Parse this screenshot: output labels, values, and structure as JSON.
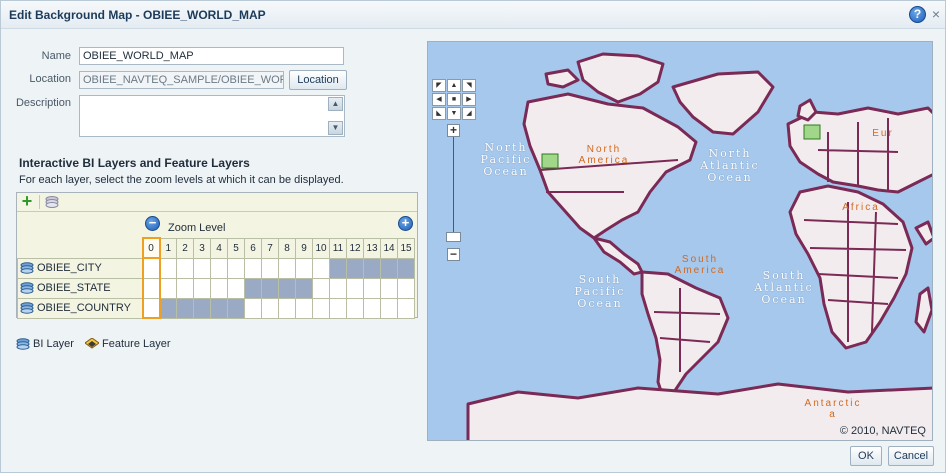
{
  "dialog": {
    "title": "Edit Background Map - OBIEE_WORLD_MAP",
    "help_glyph": "?",
    "close_glyph": "×"
  },
  "form": {
    "name_label": "Name",
    "name_value": "OBIEE_WORLD_MAP",
    "location_label": "Location",
    "location_value": "OBIEE_NAVTEQ_SAMPLE/OBIEE_WORLD_",
    "location_button": "Location",
    "description_label": "Description",
    "description_value": ""
  },
  "layers": {
    "title": "Interactive BI Layers and Feature Layers",
    "description": "For each layer, select the zoom levels at which it can be displayed.",
    "add_glyph": "+",
    "zoom_label": "Zoom Level",
    "zoom_out_glyph": "−",
    "zoom_in_glyph": "+",
    "levels": [
      "0",
      "1",
      "2",
      "3",
      "4",
      "5",
      "6",
      "7",
      "8",
      "9",
      "10",
      "11",
      "12",
      "13",
      "14",
      "15"
    ],
    "selected_level": 0,
    "rows": [
      {
        "name": "OBIEE_CITY",
        "type": "bi",
        "on": [
          11,
          12,
          13,
          14,
          15
        ]
      },
      {
        "name": "OBIEE_STATE",
        "type": "bi",
        "on": [
          6,
          7,
          8,
          9
        ]
      },
      {
        "name": "OBIEE_COUNTRY",
        "type": "bi",
        "on": [
          1,
          2,
          3,
          4,
          5
        ]
      }
    ]
  },
  "legend": {
    "bi_layer": "BI Layer",
    "feature_layer": "Feature Layer"
  },
  "map": {
    "oceans": {
      "north_pacific": "North\nPacific\nOcean",
      "north_atlantic": "North\nAtlantic\nOcean",
      "south_pacific": "South\nPacific\nOcean",
      "south_atlantic": "South\nAtlantic\nOcean"
    },
    "continents": {
      "north_america": "North\nAmerica",
      "south_america": "South\nAmerica",
      "africa": "Africa",
      "europe": "Eur",
      "antarctica": "Antarctic\na"
    },
    "copyright": "© 2010, NAVTEQ",
    "colors": {
      "ocean": "#a6c8ec",
      "land": "#f3ecef",
      "border": "#7a2a55"
    }
  },
  "footer": {
    "ok": "OK",
    "cancel": "Cancel"
  }
}
